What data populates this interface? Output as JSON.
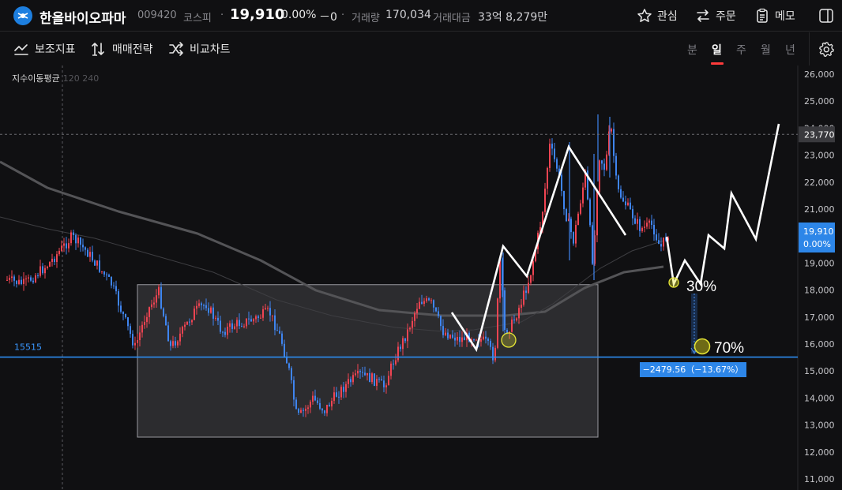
{
  "header": {
    "logo_text": "hanall-logo",
    "stock_name": "한올바이오파마",
    "stock_code": "009420",
    "market": "코스피",
    "separator": "·",
    "price": "19,910",
    "change_pct": "0.00%",
    "change_abs": "－0",
    "volume_label": "거래량",
    "volume_value": "170,034",
    "amount_label": "거래대금",
    "amount_value": "33억 8,279만",
    "buttons": {
      "watch": "관심",
      "order": "주문",
      "memo": "메모"
    }
  },
  "toolbar": {
    "indicators": "보조지표",
    "strategy": "매매전략",
    "compare": "비교차트",
    "periods": [
      "분",
      "일",
      "주",
      "월",
      "년"
    ],
    "active_period": "일"
  },
  "chart_data": {
    "type": "candlestick",
    "legend": {
      "title": "지수이동평균",
      "params": "120 240"
    },
    "y_axis": {
      "min": 11000,
      "max": 26000,
      "ticks": [
        "26,000",
        "25,000",
        "24,000",
        "23,000",
        "22,000",
        "21,000",
        "20,000",
        "19,000",
        "18,000",
        "17,000",
        "16,000",
        "15,000",
        "14,000",
        "13,000",
        "12,000",
        "11,000"
      ]
    },
    "current_price": {
      "value": 19910,
      "label": "19,910",
      "change": "0.00%"
    },
    "crosshair_price": {
      "value": 23770,
      "label": "23,770"
    },
    "horizontal_line": {
      "value": 15515,
      "label": "15515"
    },
    "range_box": {
      "from": 18200,
      "to": 12550
    },
    "projection": {
      "target": 15515,
      "change_label": "−2479.56（−13.67%）"
    },
    "annotations": [
      "30%",
      "70%"
    ],
    "colors": {
      "up": "#f04452",
      "down": "#3f85f0",
      "hline": "#2d8cf0",
      "projection": "#ffffff",
      "marker": "#e6e635"
    }
  }
}
